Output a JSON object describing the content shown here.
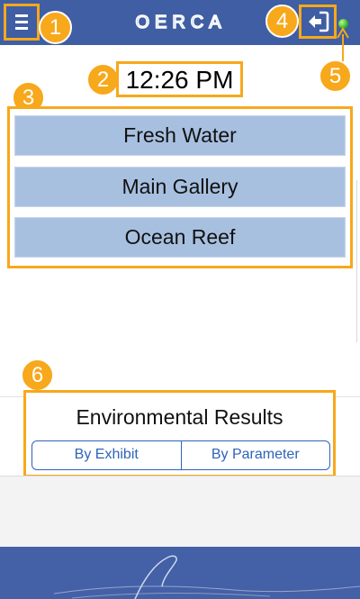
{
  "header": {
    "logo_text": "OERCA",
    "menu_icon": "hamburger-menu-icon",
    "logout_icon": "logout-arrow-icon",
    "status": "green"
  },
  "time": {
    "value": "12:26 PM"
  },
  "exhibits": [
    {
      "label": "Fresh Water"
    },
    {
      "label": "Main Gallery"
    },
    {
      "label": "Ocean Reef"
    }
  ],
  "environmental": {
    "title": "Environmental Results",
    "by_exhibit": "By Exhibit",
    "by_parameter": "By Parameter"
  },
  "callouts": [
    "1",
    "2",
    "3",
    "4",
    "5",
    "6"
  ],
  "colors": {
    "header": "#3f5ea3",
    "highlight": "#f7a81b",
    "exhibit_bg": "#a8c0e0",
    "link": "#2f63b8",
    "status_dot": "#3bb32a"
  }
}
